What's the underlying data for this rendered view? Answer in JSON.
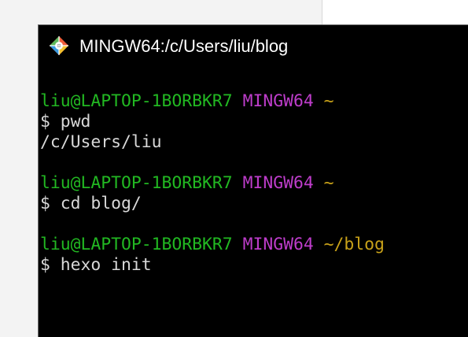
{
  "window": {
    "title": "MINGW64:/c/Users/liu/blog",
    "icon": "git-bash-icon"
  },
  "colors": {
    "user_host": "#22b822",
    "mingw": "#be3dcb",
    "path": "#c9a219",
    "text": "#d8d8d8",
    "background": "#000000"
  },
  "terminal": {
    "blocks": [
      {
        "prompt": {
          "user_host": "liu@LAPTOP-1BORBKR7",
          "env": "MINGW64",
          "path": "~"
        },
        "command": "$ pwd",
        "output": "/c/Users/liu"
      },
      {
        "prompt": {
          "user_host": "liu@LAPTOP-1BORBKR7",
          "env": "MINGW64",
          "path": "~"
        },
        "command": "$ cd blog/"
      },
      {
        "prompt": {
          "user_host": "liu@LAPTOP-1BORBKR7",
          "env": "MINGW64",
          "path": "~/blog"
        },
        "command": "$ hexo init"
      }
    ]
  }
}
